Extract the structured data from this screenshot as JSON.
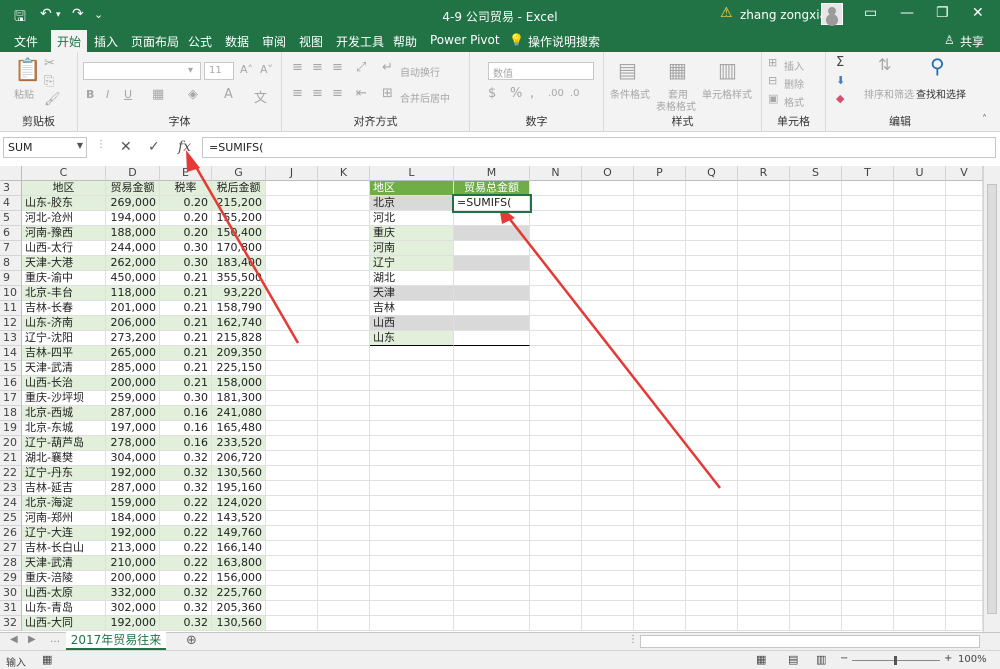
{
  "titlebar": {
    "title": "4-9 公司贸易  -  Excel",
    "user": "zhang zongxian",
    "save_icon": "save-icon",
    "undo_icon": "undo-icon",
    "redo_icon": "redo-icon"
  },
  "ribbon_tabs": [
    "文件",
    "开始",
    "插入",
    "页面布局",
    "公式",
    "数据",
    "审阅",
    "视图",
    "开发工具",
    "帮助",
    "Power Pivot"
  ],
  "tell_me": "操作说明搜索",
  "share": "共享",
  "ribbon": {
    "clipboard": {
      "label": "剪贴板",
      "paste": "粘贴"
    },
    "font": {
      "label": "字体",
      "size": "11",
      "bold": "B",
      "italic": "I",
      "underline": "U"
    },
    "alignment": {
      "label": "对齐方式",
      "wrap": "自动换行",
      "merge": "合并后居中"
    },
    "number": {
      "label": "数字",
      "format": "数值"
    },
    "styles": {
      "label": "样式",
      "cond": "条件格式",
      "table1": "套用",
      "table2": "表格格式",
      "cell": "单元格样式"
    },
    "cells": {
      "label": "单元格",
      "insert": "插入",
      "delete": "删除",
      "format": "格式"
    },
    "editing": {
      "label": "编辑",
      "sort": "排序和筛选",
      "find": "查找和选择",
      "sigma": "Σ"
    }
  },
  "formula_bar": {
    "name_box": "SUM",
    "cancel": "✕",
    "enter": "✓",
    "fx": "fx",
    "formula": "=SUMIFS("
  },
  "columns": [
    "C",
    "D",
    "E",
    "F",
    "G",
    "J",
    "K",
    "L",
    "M",
    "N",
    "O",
    "P",
    "Q",
    "R",
    "S",
    "T",
    "U",
    "V"
  ],
  "left_table": {
    "headers": [
      "地区",
      "贸易金额",
      "税率",
      "税后金额"
    ],
    "rows": [
      [
        "3",
        "地区",
        "贸易金额",
        "税率",
        "税后金额"
      ],
      [
        "4",
        "山东-胶东",
        "269,000",
        "0.20",
        "215,200"
      ],
      [
        "5",
        "河北-沧州",
        "194,000",
        "0.20",
        "155,200"
      ],
      [
        "6",
        "河南-豫西",
        "188,000",
        "0.20",
        "150,400"
      ],
      [
        "7",
        "山西-太行",
        "244,000",
        "0.30",
        "170,800"
      ],
      [
        "8",
        "天津-大港",
        "262,000",
        "0.30",
        "183,400"
      ],
      [
        "9",
        "重庆-渝中",
        "450,000",
        "0.21",
        "355,500"
      ],
      [
        "10",
        "北京-丰台",
        "118,000",
        "0.21",
        "93,220"
      ],
      [
        "11",
        "吉林-长春",
        "201,000",
        "0.21",
        "158,790"
      ],
      [
        "12",
        "山东-济南",
        "206,000",
        "0.21",
        "162,740"
      ],
      [
        "13",
        "辽宁-沈阳",
        "273,200",
        "0.21",
        "215,828"
      ],
      [
        "14",
        "吉林-四平",
        "265,000",
        "0.21",
        "209,350"
      ],
      [
        "15",
        "天津-武清",
        "285,000",
        "0.21",
        "225,150"
      ],
      [
        "16",
        "山西-长治",
        "200,000",
        "0.21",
        "158,000"
      ],
      [
        "17",
        "重庆-沙坪坝",
        "259,000",
        "0.30",
        "181,300"
      ],
      [
        "18",
        "北京-西城",
        "287,000",
        "0.16",
        "241,080"
      ],
      [
        "19",
        "北京-东城",
        "197,000",
        "0.16",
        "165,480"
      ],
      [
        "20",
        "辽宁-葫芦岛",
        "278,000",
        "0.16",
        "233,520"
      ],
      [
        "21",
        "湖北-襄樊",
        "304,000",
        "0.32",
        "206,720"
      ],
      [
        "22",
        "辽宁-丹东",
        "192,000",
        "0.32",
        "130,560"
      ],
      [
        "23",
        "吉林-延吉",
        "287,000",
        "0.32",
        "195,160"
      ],
      [
        "24",
        "北京-海淀",
        "159,000",
        "0.22",
        "124,020"
      ],
      [
        "25",
        "河南-郑州",
        "184,000",
        "0.22",
        "143,520"
      ],
      [
        "26",
        "辽宁-大连",
        "192,000",
        "0.22",
        "149,760"
      ],
      [
        "27",
        "吉林-长白山",
        "213,000",
        "0.22",
        "166,140"
      ],
      [
        "28",
        "天津-武清",
        "210,000",
        "0.22",
        "163,800"
      ],
      [
        "29",
        "重庆-涪陵",
        "200,000",
        "0.22",
        "156,000"
      ],
      [
        "30",
        "山西-太原",
        "332,000",
        "0.32",
        "225,760"
      ],
      [
        "31",
        "山东-青岛",
        "302,000",
        "0.32",
        "205,360"
      ],
      [
        "32",
        "山西-大同",
        "192,000",
        "0.32",
        "130,560"
      ]
    ]
  },
  "right_table": {
    "header_region": "地区",
    "header_total": "贸易总金额",
    "regions": [
      "北京",
      "河北",
      "重庆",
      "河南",
      "辽宁",
      "湖北",
      "天津",
      "吉林",
      "山西",
      "山东"
    ],
    "active_formula": "=SUMIFS("
  },
  "sheet_tab": "2017年贸易往来",
  "status": {
    "mode": "输入",
    "zoom": "100%"
  },
  "colors": {
    "excel_green": "#217346",
    "band_green": "#e2efda",
    "header_green": "#70ad47",
    "band_gray": "#d9d9d9",
    "arrow_red": "#e53935"
  }
}
